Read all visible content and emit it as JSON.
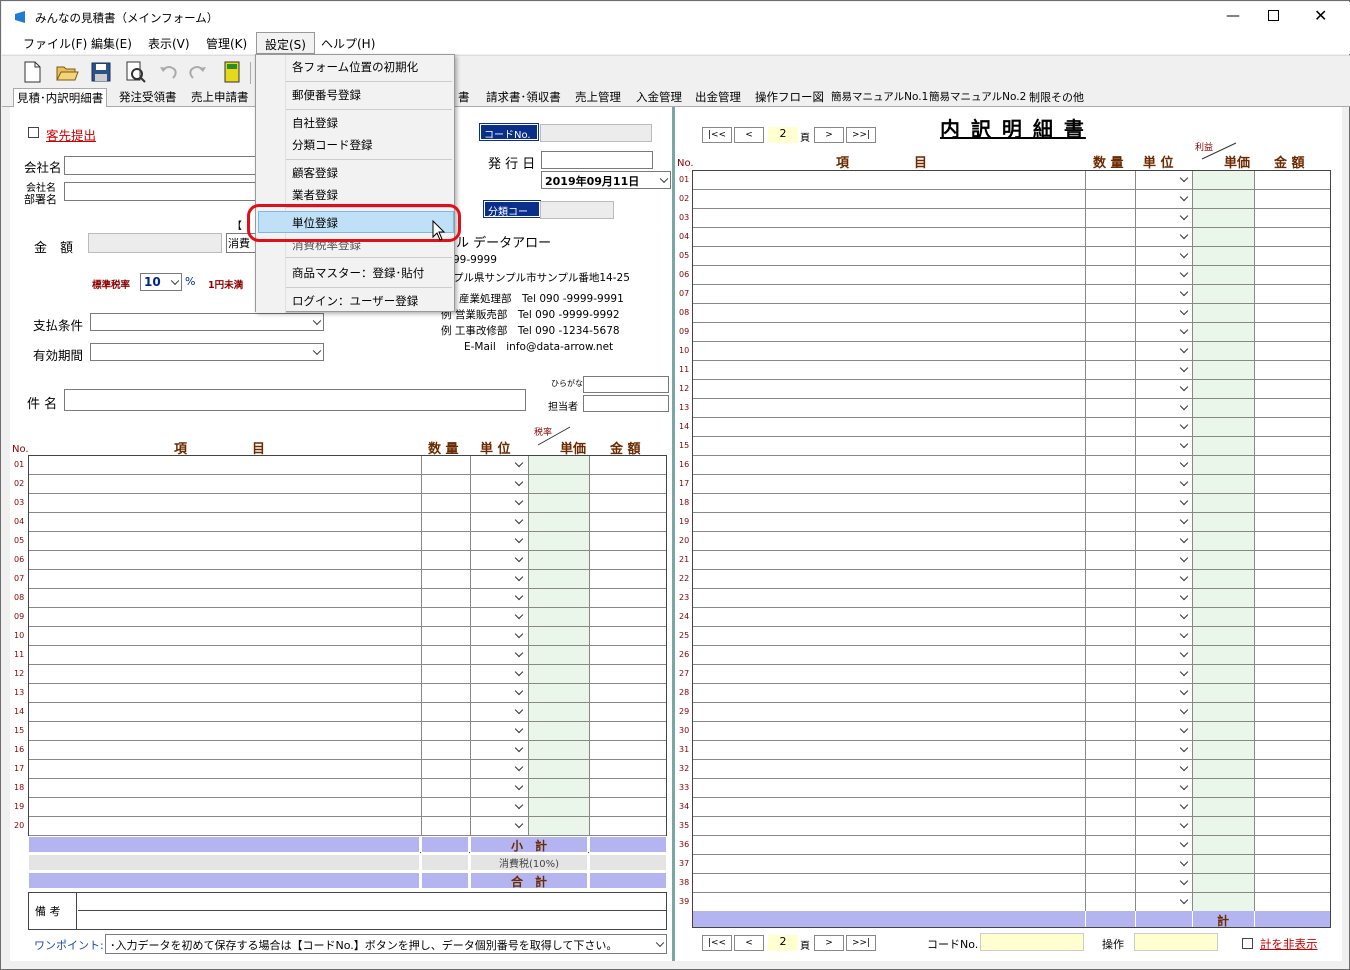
{
  "window": {
    "title": "みんなの見積書（メインフォーム）"
  },
  "menu": [
    "ファイル(F)",
    "編集(E)",
    "表示(V)",
    "管理(K)",
    "設定(S)",
    "ヘルプ(H)"
  ],
  "tabs": [
    "見積･内訳明細書",
    "発注受領書",
    "売上申請書",
    "書",
    "請求書･領収書",
    "売上管理",
    "入金管理",
    "出金管理",
    "操作フロー図",
    "簡易マニュアルNo.1",
    "簡易マニュアルNo.2",
    "制限その他"
  ],
  "settings_menu": [
    "各フォーム位置の初期化",
    "郵便番号登録",
    "自社登録",
    "分類コード登録",
    "顧客登録",
    "業者登録",
    "単位登録",
    "消費税率登録",
    "商品マスター：登録･貼付",
    "ログイン：ユーザー登録"
  ],
  "left": {
    "submit_label": "客先提出",
    "company_name": "会社名",
    "dept_name_1": "会社名",
    "dept_name_2": "部署名",
    "amount_label": "金　額",
    "tax_label_short": "消費",
    "bracket_label": "【",
    "tax_rate_label": "標準税率",
    "tax_rate_value": "10",
    "percent": "%",
    "rounding": "1円未満",
    "payment_terms": "支払条件",
    "validity": "有効期間",
    "subject": "件 名",
    "code_no": "コードNo.",
    "issue_date_label": "発 行 日",
    "issue_date": "2019年09月11日",
    "category_code": "分類コード",
    "company_name_own": "ル データアロー",
    "postal": "99-9999",
    "address": "プル県サンプル市サンプル番地14-25",
    "dept1": "産業処理部　Tel 090 -9999-9991",
    "dept2": "例 営業販売部　Tel 090 -9999-9992",
    "dept3": "例 工事改修部　Tel 090 -1234-5678",
    "email": "E-Mail　info@data-arrow.net",
    "furigana": "ひらがな",
    "staff": "担当者",
    "col_no": "No.",
    "col_item": "項　　　　　目",
    "col_qty": "数 量",
    "col_unit": "単 位",
    "col_taxrate": "税率",
    "col_price": "単価",
    "col_amount": "金 額",
    "subtotal": "小　計",
    "consumption_tax": "消費税(10%)",
    "total": "合　計",
    "notes": "備 考",
    "onepoint_label": "ワンポイント:",
    "onepoint_text": "･入力データを初めて保存する場合は【コードNo.】ボタンを押し、データ個別番号を取得して下さい。"
  },
  "right": {
    "title": "内 訳 明 細 書",
    "page_first": "|<<",
    "page_prev": "<",
    "page_num": "2",
    "page_unit": "頁",
    "page_next": ">",
    "page_last": ">>|",
    "col_no": "No.",
    "col_item": "項　　　　　目",
    "col_qty": "数 量",
    "col_unit": "単 位",
    "col_profit": "利益",
    "col_price": "単価",
    "col_amount": "金 額",
    "total": "計",
    "code_no": "コードNo.",
    "operation": "操作",
    "hide_total": "計を非表示"
  },
  "left_rows": [
    "01",
    "02",
    "03",
    "04",
    "05",
    "06",
    "07",
    "08",
    "09",
    "10",
    "11",
    "12",
    "13",
    "14",
    "15",
    "16",
    "17",
    "18",
    "19",
    "20"
  ],
  "right_rows": [
    "01",
    "02",
    "03",
    "04",
    "05",
    "06",
    "07",
    "08",
    "09",
    "10",
    "11",
    "12",
    "13",
    "14",
    "15",
    "16",
    "17",
    "18",
    "19",
    "20",
    "21",
    "22",
    "23",
    "24",
    "25",
    "26",
    "27",
    "28",
    "29",
    "30",
    "31",
    "32",
    "33",
    "34",
    "35",
    "36",
    "37",
    "38",
    "39"
  ]
}
